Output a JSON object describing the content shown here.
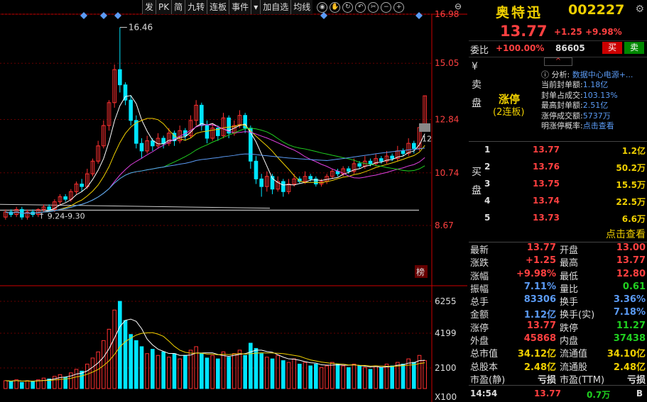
{
  "toolbar": {
    "items": [
      "发",
      "PK",
      "简",
      "九转",
      "连板",
      "事件",
      "▾",
      "加自选",
      "均线"
    ],
    "icons": [
      "eye-icon",
      "hand-icon",
      "refresh-icon",
      "undo-icon",
      "scissors-icon",
      "zoom-out-icon",
      "zoom-in-icon",
      "close-icon"
    ]
  },
  "chart": {
    "price_ticks": [
      "16.98",
      "15.05",
      "12.84",
      "10.74",
      "8.67"
    ],
    "vol_ticks": [
      "6255",
      "4199",
      "2100",
      "X100"
    ],
    "high_label": "16.46",
    "range_label": "9.24-9.30",
    "right_tag": "12",
    "rank_tag": "榜"
  },
  "chart_data": {
    "type": "candlestick",
    "ylim": [
      8.67,
      16.98
    ],
    "up_color": "#ff3030",
    "down_color": "#00e5ff",
    "candles": [
      [
        9.0,
        9.2,
        8.9,
        9.3
      ],
      [
        9.2,
        9.1,
        9.0,
        9.3
      ],
      [
        9.1,
        9.3,
        9.0,
        9.4
      ],
      [
        9.3,
        9.0,
        8.9,
        9.4
      ],
      [
        9.0,
        9.2,
        8.9,
        9.3
      ],
      [
        9.2,
        9.1,
        9.0,
        9.3
      ],
      [
        9.1,
        9.3,
        9.0,
        9.35
      ],
      [
        9.3,
        9.4,
        9.2,
        9.5
      ],
      [
        9.4,
        9.3,
        9.2,
        9.5
      ],
      [
        9.3,
        9.6,
        9.2,
        9.7
      ],
      [
        9.6,
        9.8,
        9.5,
        9.9
      ],
      [
        9.8,
        9.7,
        9.6,
        9.9
      ],
      [
        9.7,
        10.0,
        9.6,
        10.1
      ],
      [
        10.0,
        10.3,
        9.9,
        10.4
      ],
      [
        10.3,
        10.2,
        10.0,
        10.5
      ],
      [
        10.2,
        10.7,
        10.1,
        10.9
      ],
      [
        10.7,
        11.2,
        10.6,
        11.3
      ],
      [
        11.2,
        11.8,
        11.1,
        12.0
      ],
      [
        11.8,
        12.6,
        11.7,
        12.8
      ],
      [
        12.6,
        13.5,
        12.4,
        13.6
      ],
      [
        13.5,
        14.8,
        13.3,
        15.0
      ],
      [
        14.8,
        14.2,
        13.9,
        16.46
      ],
      [
        14.2,
        13.6,
        13.4,
        14.3
      ],
      [
        13.6,
        12.8,
        12.6,
        13.8
      ],
      [
        12.8,
        11.9,
        11.7,
        13.0
      ],
      [
        11.9,
        11.6,
        11.3,
        12.1
      ],
      [
        11.6,
        12.0,
        11.5,
        12.2
      ],
      [
        12.0,
        11.8,
        11.6,
        12.1
      ],
      [
        11.8,
        12.1,
        11.7,
        12.3
      ],
      [
        12.1,
        11.9,
        11.7,
        12.2
      ],
      [
        11.9,
        12.3,
        11.8,
        12.5
      ],
      [
        12.3,
        12.0,
        11.8,
        12.4
      ],
      [
        12.0,
        12.4,
        11.9,
        12.6
      ],
      [
        12.4,
        12.2,
        12.0,
        12.5
      ],
      [
        12.2,
        12.8,
        12.1,
        13.0
      ],
      [
        12.8,
        13.4,
        12.6,
        13.6
      ],
      [
        13.4,
        12.6,
        12.4,
        13.5
      ],
      [
        12.6,
        12.1,
        11.9,
        12.8
      ],
      [
        12.1,
        12.5,
        12.0,
        12.7
      ],
      [
        12.5,
        12.2,
        12.0,
        12.6
      ],
      [
        12.2,
        12.9,
        12.1,
        13.1
      ],
      [
        12.9,
        12.3,
        12.1,
        13.0
      ],
      [
        12.3,
        12.6,
        12.2,
        12.8
      ],
      [
        12.6,
        13.0,
        12.5,
        13.2
      ],
      [
        13.0,
        12.5,
        12.3,
        13.1
      ],
      [
        12.5,
        11.2,
        10.9,
        12.6
      ],
      [
        11.2,
        10.5,
        10.3,
        11.4
      ],
      [
        10.5,
        10.2,
        9.8,
        10.7
      ],
      [
        10.2,
        10.6,
        10.0,
        10.8
      ],
      [
        10.6,
        10.1,
        9.9,
        10.7
      ],
      [
        10.1,
        10.4,
        10.0,
        10.6
      ],
      [
        10.4,
        10.0,
        9.8,
        10.5
      ],
      [
        10.0,
        10.3,
        9.9,
        10.5
      ],
      [
        10.3,
        10.5,
        10.2,
        10.7
      ],
      [
        10.5,
        10.4,
        10.3,
        10.6
      ],
      [
        10.4,
        10.6,
        10.3,
        10.8
      ],
      [
        10.6,
        10.5,
        10.4,
        10.7
      ],
      [
        10.5,
        10.3,
        10.2,
        10.6
      ],
      [
        10.3,
        10.4,
        10.2,
        10.5
      ],
      [
        10.4,
        10.6,
        10.3,
        10.7
      ],
      [
        10.6,
        10.8,
        10.5,
        10.9
      ],
      [
        10.8,
        10.7,
        10.6,
        10.9
      ],
      [
        10.7,
        10.9,
        10.6,
        11.0
      ],
      [
        10.9,
        10.8,
        10.7,
        11.0
      ],
      [
        10.8,
        11.1,
        10.7,
        11.3
      ],
      [
        11.1,
        11.0,
        10.9,
        11.2
      ],
      [
        11.0,
        11.2,
        10.9,
        11.4
      ],
      [
        11.2,
        11.1,
        11.0,
        11.3
      ],
      [
        11.1,
        11.3,
        11.0,
        11.5
      ],
      [
        11.3,
        11.2,
        11.1,
        11.4
      ],
      [
        11.2,
        11.4,
        11.1,
        11.6
      ],
      [
        11.4,
        11.3,
        11.2,
        11.5
      ],
      [
        11.3,
        11.6,
        11.2,
        11.8
      ],
      [
        11.6,
        11.5,
        11.4,
        11.7
      ],
      [
        11.5,
        11.9,
        11.4,
        12.1
      ],
      [
        11.9,
        11.7,
        11.5,
        12.0
      ],
      [
        11.7,
        12.52,
        11.6,
        12.6
      ],
      [
        12.52,
        13.77,
        12.6,
        13.77
      ]
    ],
    "volumes": [
      9,
      8,
      10,
      7,
      9,
      8,
      10,
      12,
      11,
      14,
      16,
      13,
      18,
      22,
      20,
      28,
      35,
      42,
      55,
      68,
      90,
      100,
      78,
      62,
      55,
      48,
      40,
      45,
      38,
      42,
      36,
      40,
      34,
      38,
      44,
      48,
      40,
      35,
      38,
      34,
      42,
      36,
      40,
      44,
      38,
      52,
      46,
      40,
      36,
      34,
      38,
      32,
      30,
      34,
      28,
      30,
      26,
      28,
      24,
      26,
      30,
      28,
      26,
      24,
      28,
      26,
      24,
      22,
      26,
      24,
      28,
      26,
      30,
      28,
      34,
      30,
      38,
      32
    ]
  },
  "quote": {
    "name": "奥特迅",
    "code": "002227",
    "price": "13.77",
    "change": "+1.25",
    "change_pct": "+9.98%",
    "wb_label": "委比",
    "wb_pct": "+100.00%",
    "wb_diff": "86605",
    "buy_btn": "买",
    "sell_btn": "卖",
    "up_arrow": "^"
  },
  "sell_panel": {
    "side_label": "¥ 卖 盘",
    "limit_title": "涨停",
    "limit_sub": "(2连板)",
    "analysis_head": "分析:",
    "analysis_link": "数据中心电源+...",
    "rows": [
      {
        "k": "当前封单额:",
        "v": "1.18亿"
      },
      {
        "k": "封单占成交:",
        "v": "103.13%"
      },
      {
        "k": "最高封单额:",
        "v": "2.51亿"
      },
      {
        "k": "涨停成交额:",
        "v": "5737万"
      },
      {
        "k": "明涨停概率:",
        "v": "点击查看"
      }
    ]
  },
  "buy_panel": {
    "side_label": "买 盘",
    "rows": [
      {
        "lvl": "1",
        "p": "13.77",
        "v": "1.2亿"
      },
      {
        "lvl": "2",
        "p": "13.76",
        "v": "50.2万"
      },
      {
        "lvl": "3",
        "p": "13.75",
        "v": "15.5万"
      },
      {
        "lvl": "4",
        "p": "13.74",
        "v": "22.5万"
      },
      {
        "lvl": "5",
        "p": "13.73",
        "v": "6.6万"
      }
    ],
    "click_view": "点击查看"
  },
  "stats": [
    {
      "k1": "最新",
      "v1": "13.77",
      "c1": "#ff4040",
      "k2": "开盘",
      "v2": "13.00",
      "c2": "#ff4040"
    },
    {
      "k1": "涨跌",
      "v1": "+1.25",
      "c1": "#ff4040",
      "k2": "最高",
      "v2": "13.77",
      "c2": "#ff4040"
    },
    {
      "k1": "涨幅",
      "v1": "+9.98%",
      "c1": "#ff4040",
      "k2": "最低",
      "v2": "12.80",
      "c2": "#ff4040"
    },
    {
      "k1": "振幅",
      "v1": "7.11%",
      "c1": "#5b9bf5",
      "k2": "量比",
      "v2": "0.61",
      "c2": "#20d020"
    },
    {
      "k1": "总手",
      "v1": "83306",
      "c1": "#5b9bf5",
      "k2": "换手",
      "v2": "3.36%",
      "c2": "#5b9bf5"
    },
    {
      "k1": "金额",
      "v1": "1.12亿",
      "c1": "#5b9bf5",
      "k2": "换手(实)",
      "v2": "7.18%",
      "c2": "#5b9bf5"
    },
    {
      "k1": "涨停",
      "v1": "13.77",
      "c1": "#ff4040",
      "k2": "跌停",
      "v2": "11.27",
      "c2": "#20d020"
    },
    {
      "k1": "外盘",
      "v1": "45868",
      "c1": "#ff4040",
      "k2": "内盘",
      "v2": "37438",
      "c2": "#20d020"
    },
    {
      "k1": "总市值",
      "v1": "34.12亿",
      "c1": "#f0d000",
      "k2": "流通值",
      "v2": "34.10亿",
      "c2": "#f0d000"
    },
    {
      "k1": "总股本",
      "v1": "2.48亿",
      "c1": "#f0d000",
      "k2": "流通股",
      "v2": "2.48亿",
      "c2": "#f0d000"
    },
    {
      "k1": "市盈(静)",
      "v1": "亏损",
      "c1": "#ddd",
      "k2": "市盈(TTM)",
      "v2": "亏损",
      "c2": "#ddd"
    }
  ],
  "foot": {
    "time": "14:54",
    "price": "13.77",
    "vol": "0.7万",
    "dir": "B"
  }
}
